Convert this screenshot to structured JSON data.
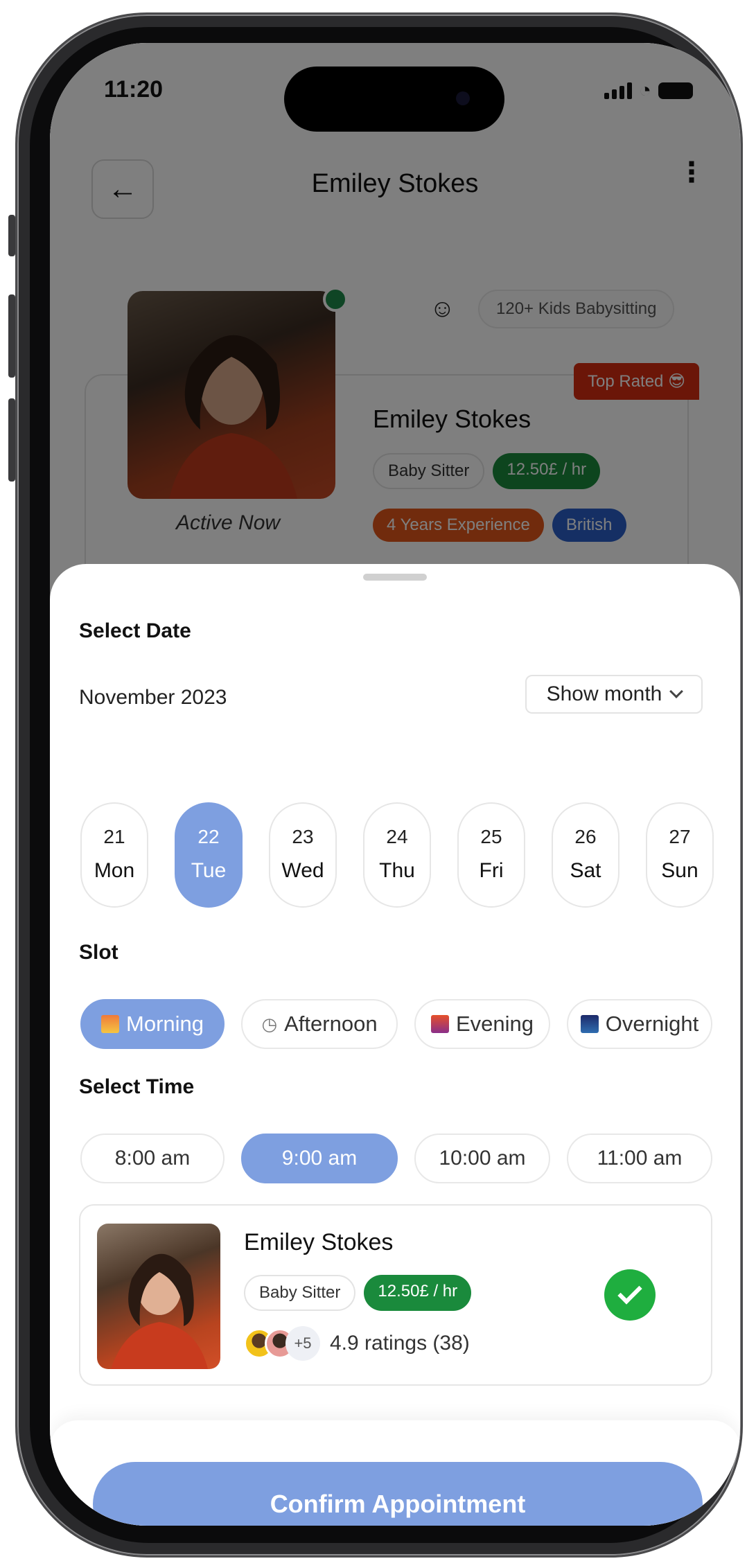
{
  "status_bar": {
    "time": "11:20"
  },
  "header": {
    "title": "Emiley Stokes",
    "back_icon": "arrow-left-icon",
    "more_icon": "kebab-menu-icon"
  },
  "profile": {
    "name": "Emiley Stokes",
    "active_status": "Active Now",
    "kids_stat": "120+ Kids Babysitting",
    "top_rated": "Top Rated 😎",
    "role": "Baby Sitter",
    "rate": "12.50£ / hr",
    "experience": "4 Years Experience",
    "nationality": "British"
  },
  "sheet": {
    "select_date_label": "Select Date",
    "month": "November 2023",
    "show_month_label": "Show month",
    "days": [
      {
        "num": "21",
        "name": "Mon",
        "selected": false
      },
      {
        "num": "22",
        "name": "Tue",
        "selected": true
      },
      {
        "num": "23",
        "name": "Wed",
        "selected": false
      },
      {
        "num": "24",
        "name": "Thu",
        "selected": false
      },
      {
        "num": "25",
        "name": "Fri",
        "selected": false
      },
      {
        "num": "26",
        "name": "Sat",
        "selected": false
      },
      {
        "num": "27",
        "name": "Sun",
        "selected": false
      }
    ],
    "slot_label": "Slot",
    "slots": [
      {
        "label": "Morning",
        "icon": "sunrise-icon",
        "selected": true
      },
      {
        "label": "Afternoon",
        "icon": "clock-icon",
        "selected": false
      },
      {
        "label": "Evening",
        "icon": "city-sunset-icon",
        "selected": false
      },
      {
        "label": "Overnight",
        "icon": "night-city-icon",
        "selected": false
      }
    ],
    "select_time_label": "Select Time",
    "times": [
      {
        "label": "8:00 am",
        "selected": false
      },
      {
        "label": "9:00 am",
        "selected": true
      },
      {
        "label": "10:00 am",
        "selected": false
      },
      {
        "label": "11:00 am",
        "selected": false
      }
    ],
    "sitter": {
      "name": "Emiley Stokes",
      "role": "Baby Sitter",
      "rate": "12.50£ / hr",
      "more_reviewers": "+5",
      "ratings": "4.9 ratings (38)",
      "selected": true
    },
    "confirm_label": "Confirm Appointment"
  },
  "colors": {
    "accent": "#7e9fe0",
    "green": "#1a8a3c",
    "check_green": "#1fae3f",
    "top_rated_red": "#d62d10",
    "experience_orange": "#e2571a",
    "nationality_blue": "#2a5fc8"
  }
}
